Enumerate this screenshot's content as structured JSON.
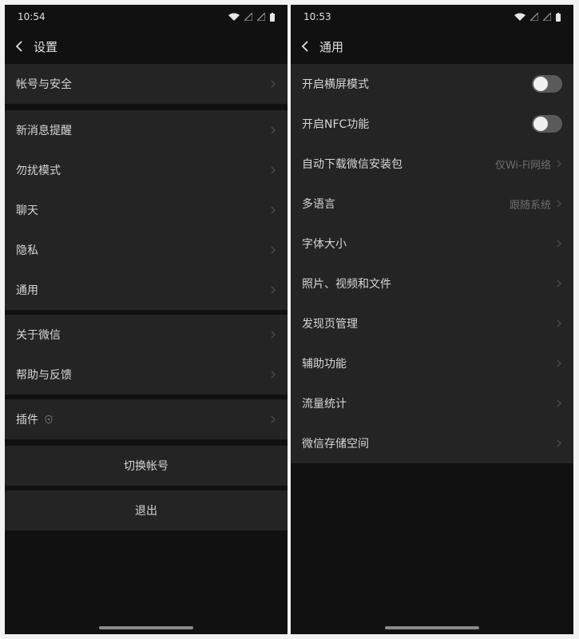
{
  "left": {
    "status": {
      "time": "10:54"
    },
    "header": {
      "title": "设置"
    },
    "groups": [
      [
        "帐号与安全"
      ],
      [
        "新消息提醒",
        "勿扰模式",
        "聊天",
        "隐私",
        "通用"
      ],
      [
        "关于微信",
        "帮助与反馈"
      ],
      [
        "插件"
      ]
    ],
    "buttons": {
      "switch_account": "切换帐号",
      "logout": "退出"
    }
  },
  "right": {
    "status": {
      "time": "10:53"
    },
    "header": {
      "title": "通用"
    },
    "rows": [
      {
        "label": "开启横屏模式",
        "toggle": false
      },
      {
        "label": "开启NFC功能",
        "toggle": false
      },
      {
        "label": "自动下载微信安装包",
        "value": "仅Wi-Fi网络"
      },
      {
        "label": "多语言",
        "value": "跟随系统"
      },
      {
        "label": "字体大小"
      },
      {
        "label": "照片、视频和文件"
      },
      {
        "label": "发现页管理"
      },
      {
        "label": "辅助功能"
      },
      {
        "label": "流量统计"
      },
      {
        "label": "微信存储空间"
      }
    ]
  },
  "colors": {
    "background": "#111111",
    "cell": "#242424",
    "text": "#d6d6d6",
    "secondary_text": "#6d6d6d"
  }
}
